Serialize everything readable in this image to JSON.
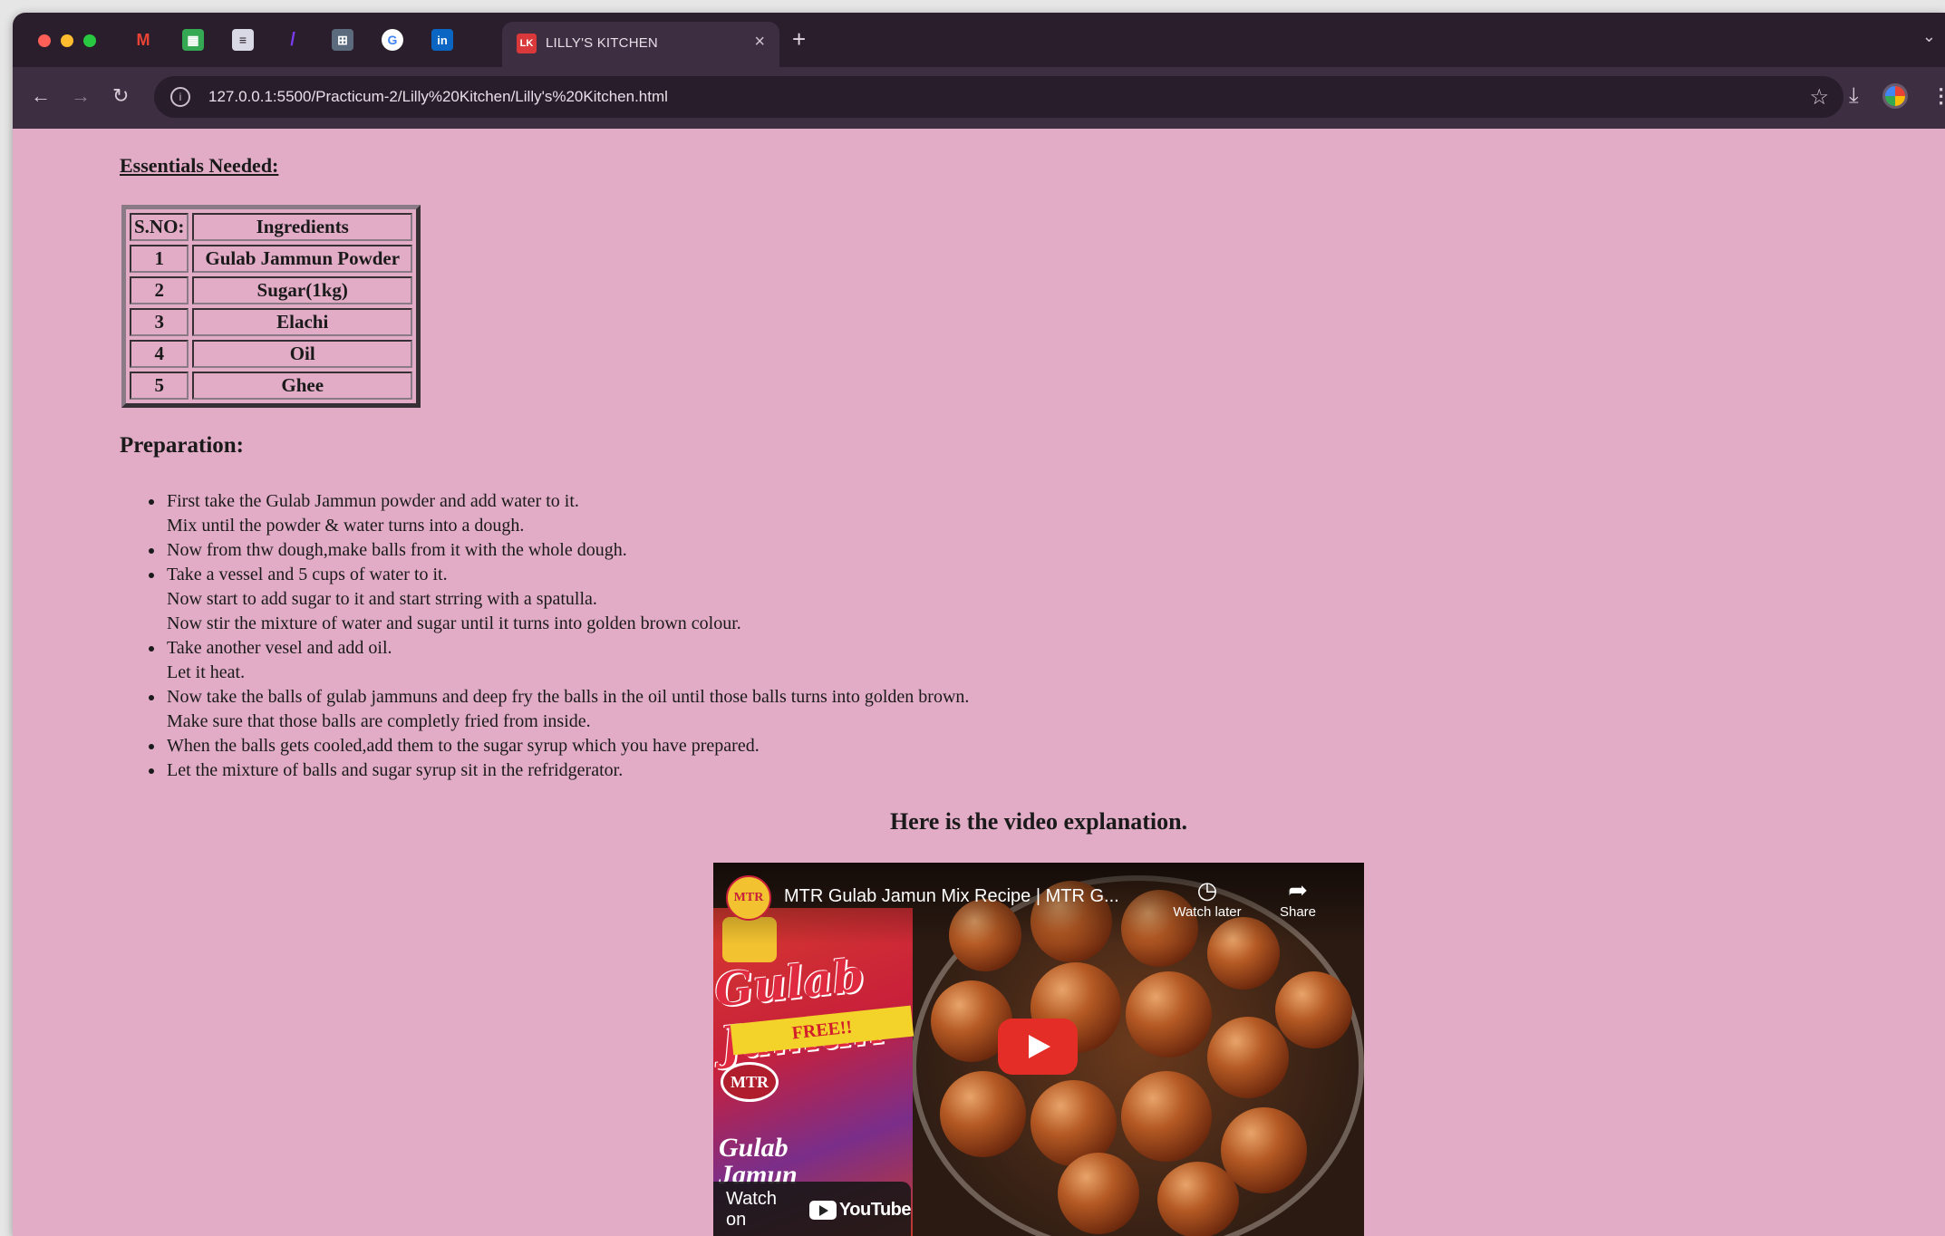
{
  "browser": {
    "pinned_tabs": [
      {
        "icon": "gmail-icon",
        "glyph": "M"
      },
      {
        "icon": "sheets-icon",
        "glyph": "▦"
      },
      {
        "icon": "docs-icon",
        "glyph": "≡"
      },
      {
        "icon": "yahoo-icon",
        "glyph": "/"
      },
      {
        "icon": "app-icon",
        "glyph": "⊞"
      },
      {
        "icon": "google-icon",
        "glyph": "G"
      },
      {
        "icon": "linkedin-icon",
        "glyph": "in"
      }
    ],
    "active_tab": {
      "title": "LILLY'S KITCHEN",
      "favicon_glyph": "LK"
    },
    "url": "127.0.0.1:5500/Practicum-2/Lilly%20Kitchen/Lilly's%20Kitchen.html",
    "accent": "#e2acc6"
  },
  "page": {
    "essentials_heading": "Essentials Needed:",
    "table": {
      "headers": [
        "S.NO:",
        "Ingredients"
      ],
      "rows": [
        [
          "1",
          "Gulab Jammun Powder"
        ],
        [
          "2",
          "Sugar(1kg)"
        ],
        [
          "3",
          "Elachi"
        ],
        [
          "4",
          "Oil"
        ],
        [
          "5",
          "Ghee"
        ]
      ]
    },
    "preparation_heading": "Preparation:",
    "steps": [
      "First take the Gulab Jammun powder and add water to it.\nMix until the powder & water turns into a dough.",
      "Now from thw dough,make balls from it with the whole dough.",
      "Take a vessel and 5 cups of water to it.\nNow start to add sugar to it and start strring with a spatulla.\nNow stir the mixture of water and sugar until it turns into golden brown colour.",
      "Take another vesel and add oil.\nLet it heat.",
      "Now take the balls of gulab jammuns and deep fry the balls in the oil until those balls turns into golden brown.\nMake sure that those balls are completly fried from inside.",
      "When the balls gets cooled,add them to the sugar syrup which you have prepared.",
      "Let the mixture of balls and sugar syrup sit in the refridgerator."
    ],
    "video_heading": "Here is the video explanation.",
    "video": {
      "title": "MTR Gulab Jamun Mix Recipe | MTR G...",
      "watch_later": "Watch later",
      "share": "Share",
      "watch_on": "Watch on",
      "youtube": "YouTube",
      "thumbnail_text": {
        "brand": "MTR",
        "product": "Gulab Jamun",
        "offer": "FREE!!",
        "sub": "Gulab\nJamun"
      }
    }
  }
}
